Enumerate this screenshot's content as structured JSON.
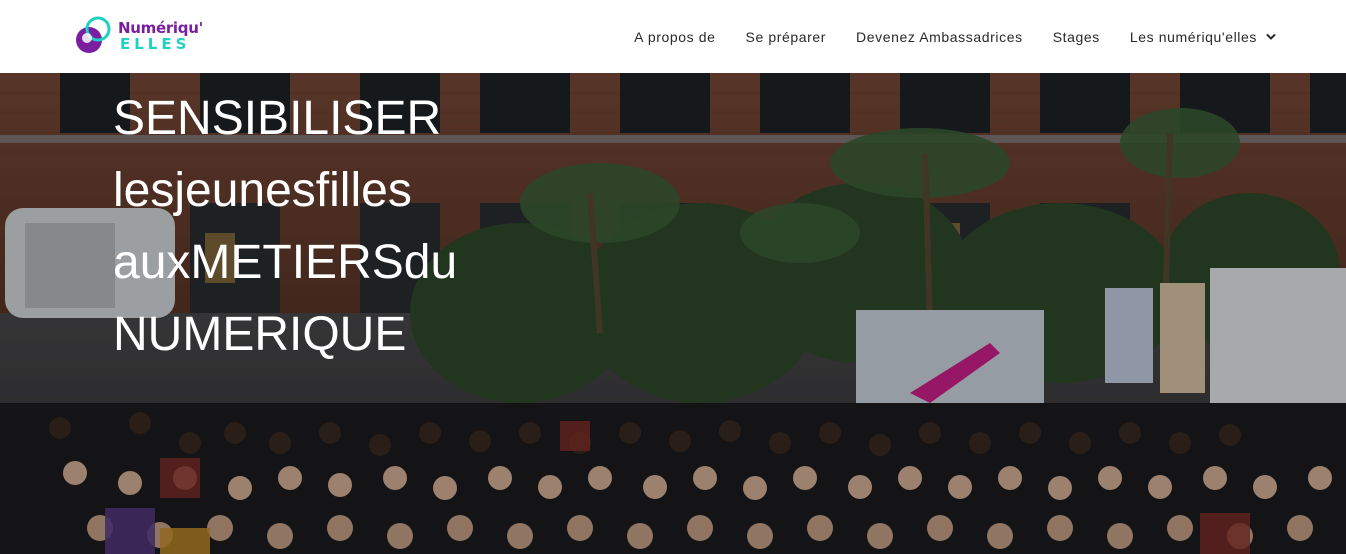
{
  "brand": {
    "name_top": "Numériqu'",
    "name_bottom": "ELLES",
    "colors": {
      "purple": "#7a1fa0",
      "teal": "#1ed1c2"
    }
  },
  "nav": {
    "items": [
      {
        "label": "A propos de"
      },
      {
        "label": "Se préparer"
      },
      {
        "label": "Devenez Ambassadrices"
      },
      {
        "label": "Stages"
      },
      {
        "label": "Les numériqu'elles",
        "icon": "chevron-down-icon"
      }
    ]
  },
  "hero": {
    "lines": [
      "SENSIBILISER",
      "lesjeunesfilles",
      "auxMETIERSdu",
      "NUMERIQUE"
    ],
    "background": "crowd-photo"
  }
}
